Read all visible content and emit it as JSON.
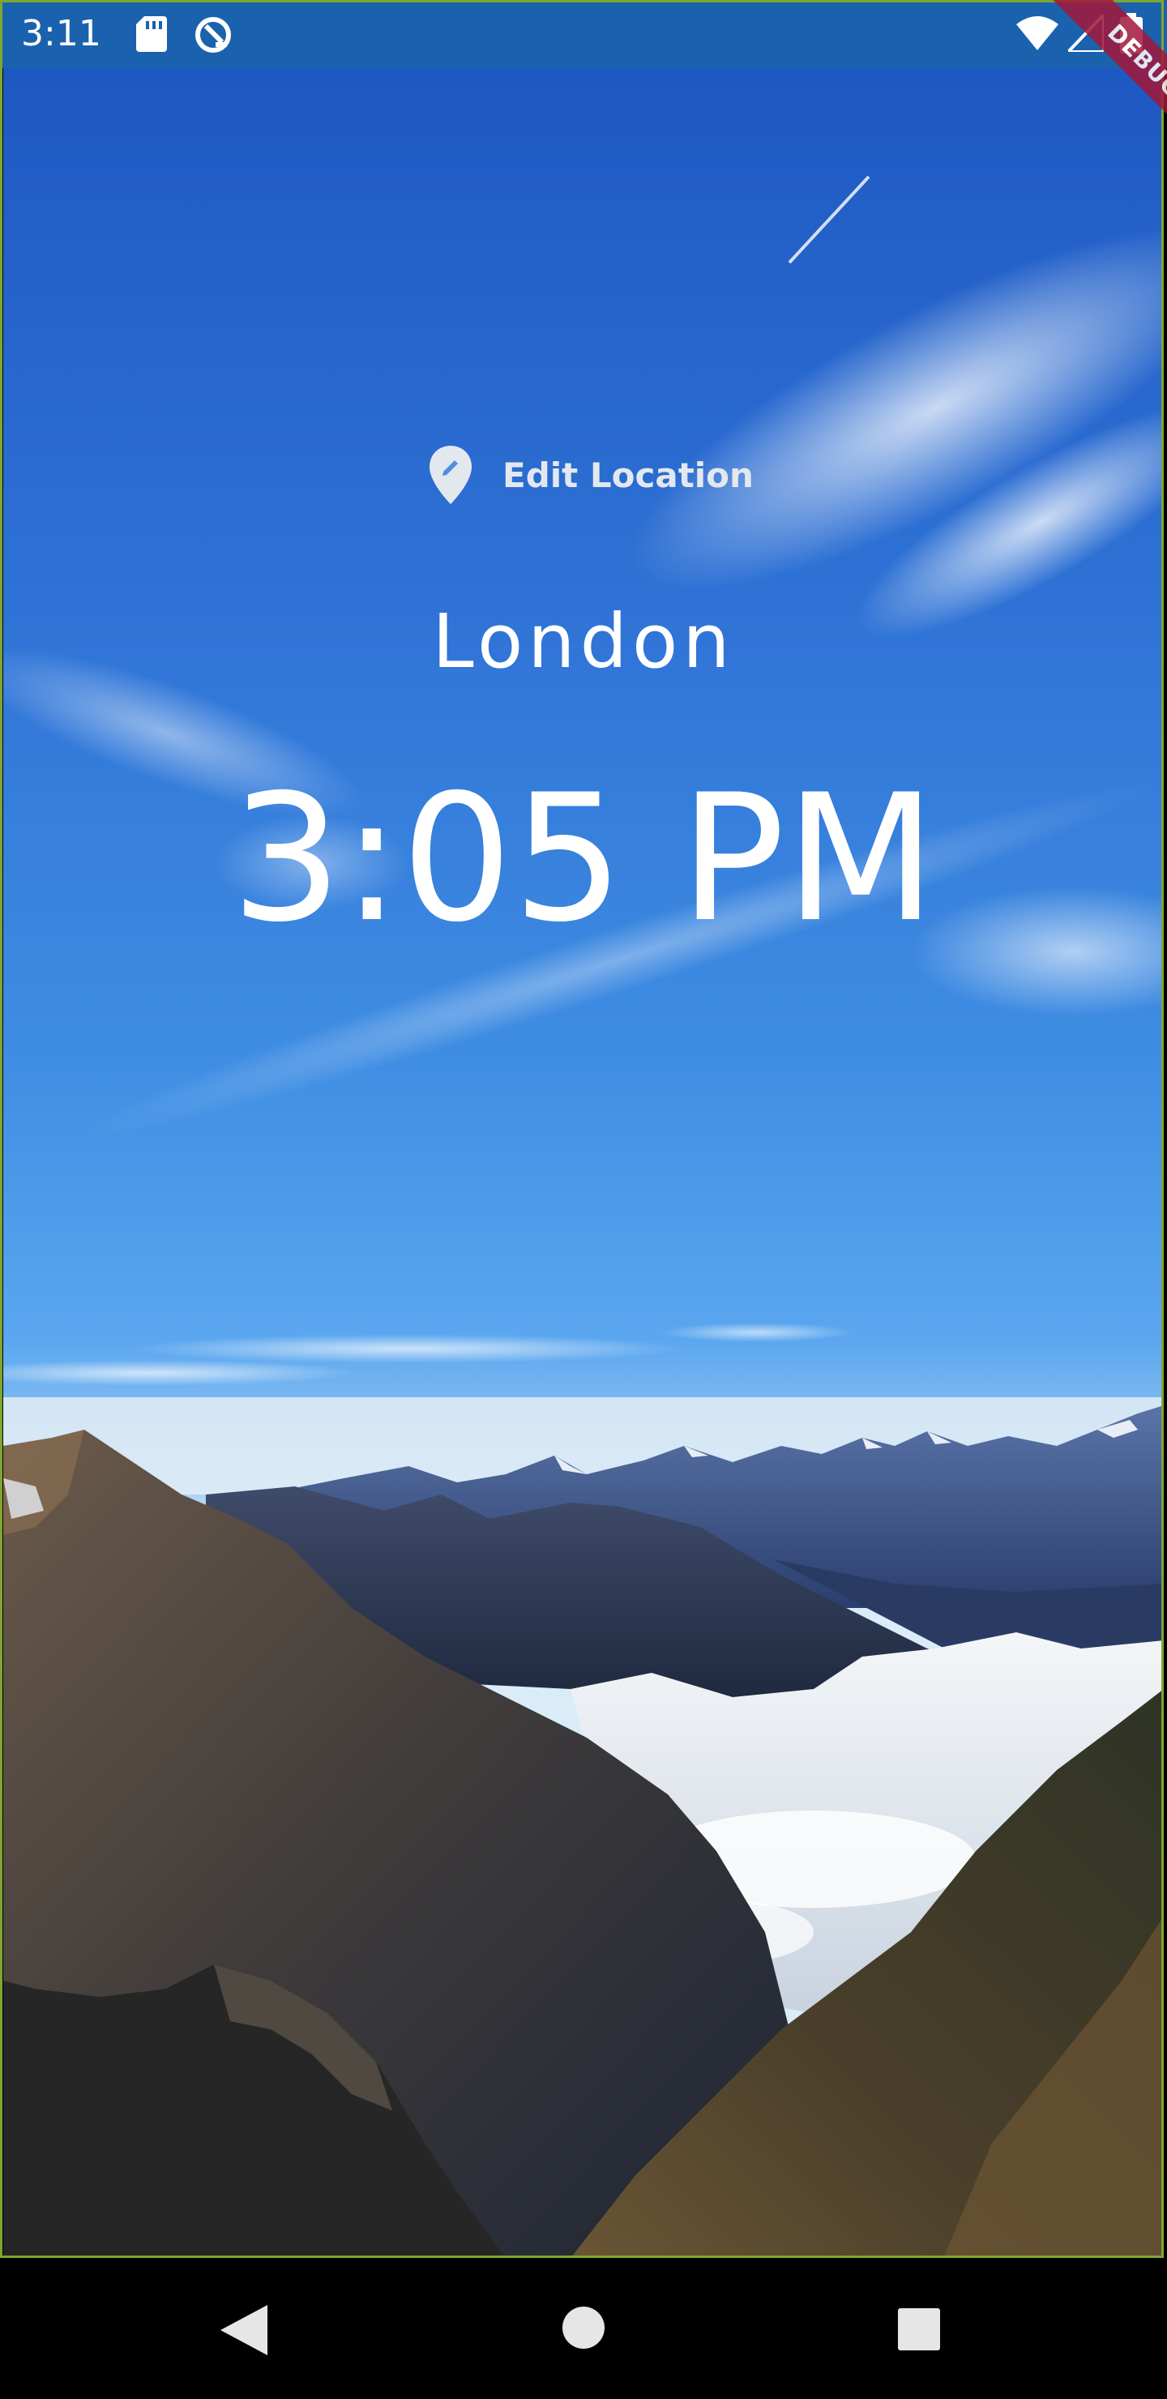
{
  "status_bar": {
    "time": "3:11",
    "icons": [
      "sd-card-icon",
      "sync-icon",
      "wifi-icon",
      "signal-icon",
      "battery-icon"
    ]
  },
  "debug_banner": {
    "label": "DEBUG",
    "color": "#a3173a"
  },
  "location": {
    "edit_label": "Edit Location",
    "icon": "location-edit-icon",
    "name": "London"
  },
  "clock": {
    "time": "3:05 PM"
  },
  "nav_bar": {
    "buttons": [
      "back-icon",
      "home-icon",
      "recents-icon"
    ]
  },
  "colors": {
    "status_bar": "#1a62ad",
    "frame_border": "#7fa62e",
    "text": "#ffffff"
  }
}
